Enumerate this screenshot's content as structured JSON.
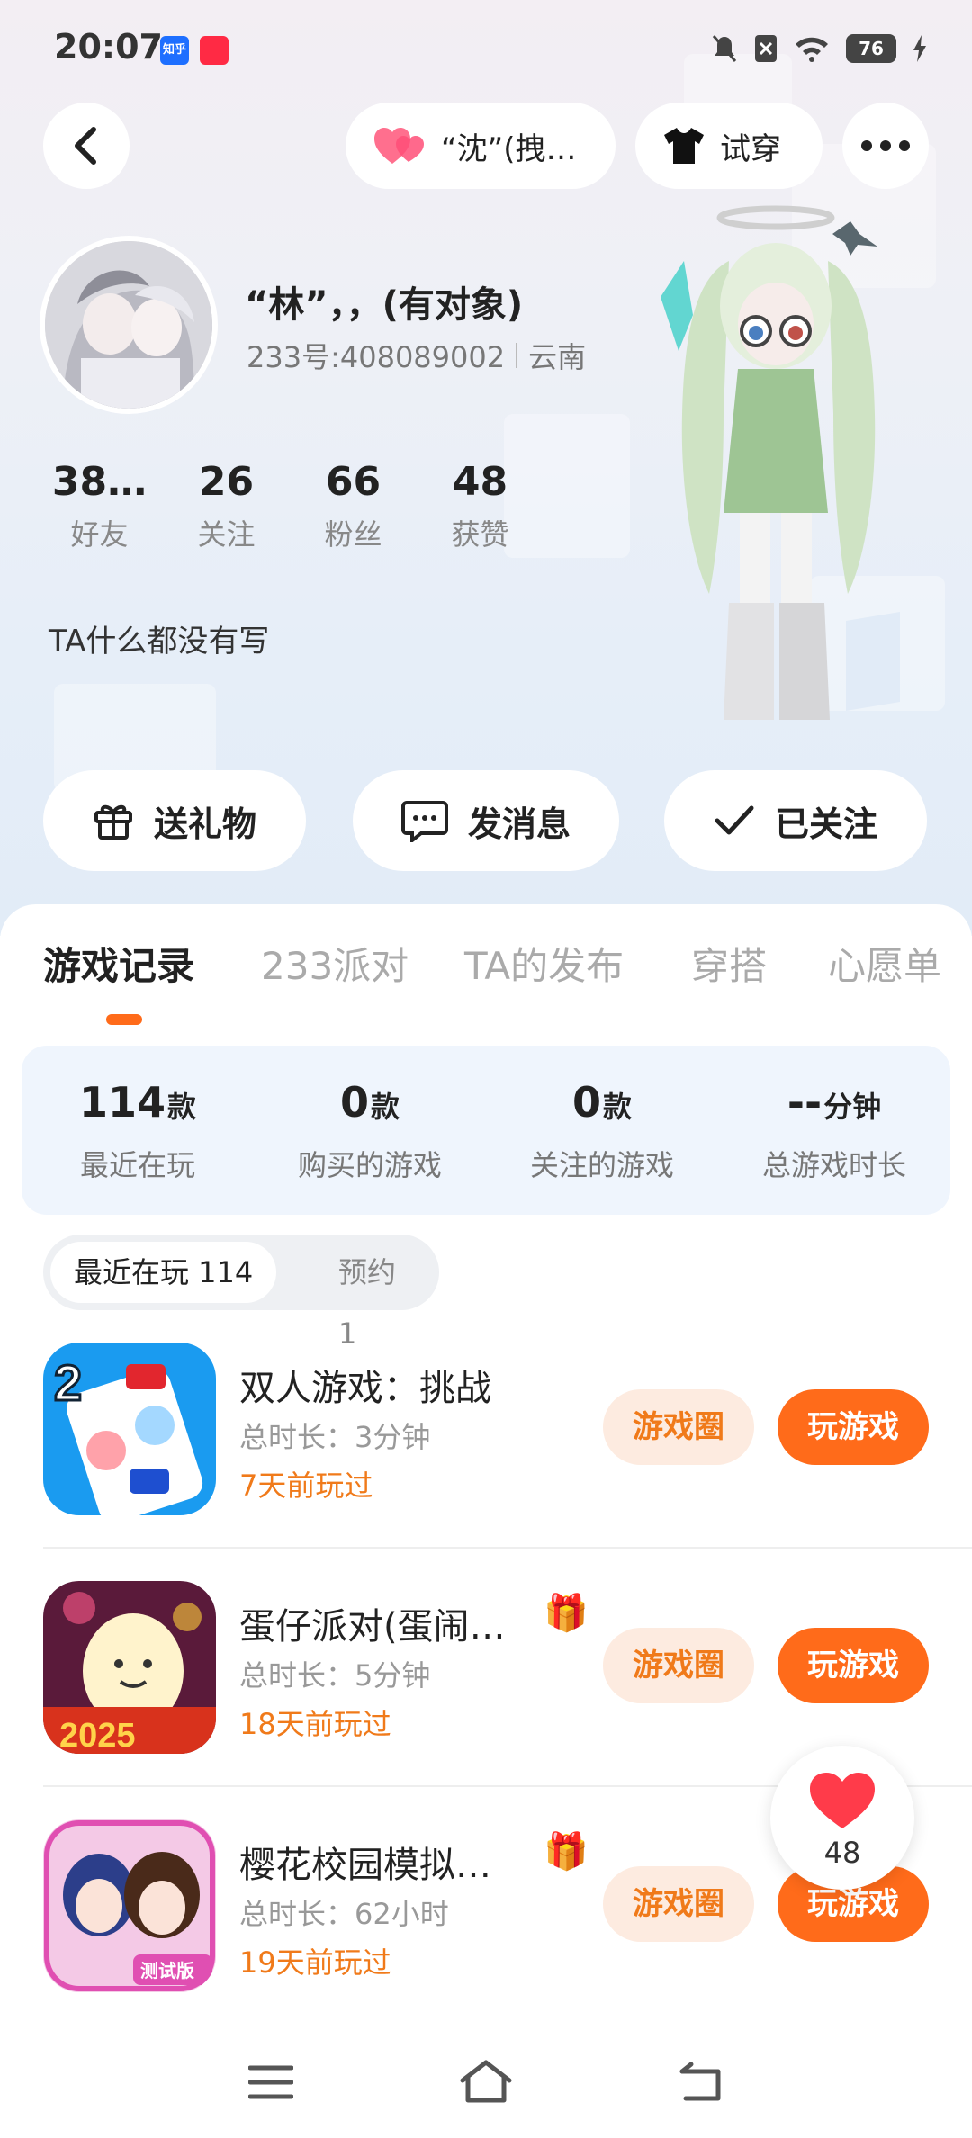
{
  "status_bar": {
    "time": "20:07",
    "app_icons": [
      {
        "name": "zhihu-app-icon",
        "label": "知乎",
        "color": "#1e6fff"
      },
      {
        "name": "xiaohongshu-app-icon",
        "label": "",
        "color": "#ff2a44"
      }
    ],
    "battery": "76"
  },
  "top_nav": {
    "back_icon": "chevron-left-icon",
    "couple_label": "“沈”(拽…",
    "try_on_label": "试穿",
    "more_icon": "more-horizontal-icon"
  },
  "profile": {
    "name": "“林”，，(有对象)",
    "id_text": "233号:408089002",
    "region": "云南",
    "bio": "TA什么都没有写",
    "stats": [
      {
        "num": "38…",
        "label": "好友"
      },
      {
        "num": "26",
        "label": "关注"
      },
      {
        "num": "66",
        "label": "粉丝"
      },
      {
        "num": "48",
        "label": "获赞"
      }
    ]
  },
  "actions": {
    "gift": "送礼物",
    "message": "发消息",
    "followed": "已关注"
  },
  "tabs": [
    "游戏记录",
    "233派对",
    "TA的发布",
    "穿搭",
    "心愿单"
  ],
  "active_tab": "游戏记录",
  "summary": [
    {
      "value": "114",
      "unit": "款",
      "label": "最近在玩"
    },
    {
      "value": "0",
      "unit": "款",
      "label": "购买的游戏"
    },
    {
      "value": "0",
      "unit": "款",
      "label": "关注的游戏"
    },
    {
      "value": "--",
      "unit": "分钟",
      "label": "总游戏时长"
    }
  ],
  "segment": {
    "recent": "最近在玩 114",
    "reserved": "预约 1"
  },
  "games": [
    {
      "title": "双人游戏：挑战",
      "duration": "总时长：3分钟",
      "last_played": "7天前玩过",
      "has_gift": false,
      "circle_label": "游戏圈",
      "play_label": "玩游戏"
    },
    {
      "title": "蛋仔派对(蛋闹…",
      "duration": "总时长：5分钟",
      "last_played": "18天前玩过",
      "has_gift": true,
      "circle_label": "游戏圈",
      "play_label": "玩游戏"
    },
    {
      "title": "樱花校园模拟…",
      "duration": "总时长：62小时",
      "last_played": "19天前玩过",
      "has_gift": true,
      "circle_label": "游戏圈",
      "play_label": "玩游戏"
    }
  ],
  "like_fab": {
    "count": "48"
  },
  "colors": {
    "accent": "#ff6b1a",
    "accent_light": "#fdebe0",
    "summary_bg": "#eff5fd"
  }
}
